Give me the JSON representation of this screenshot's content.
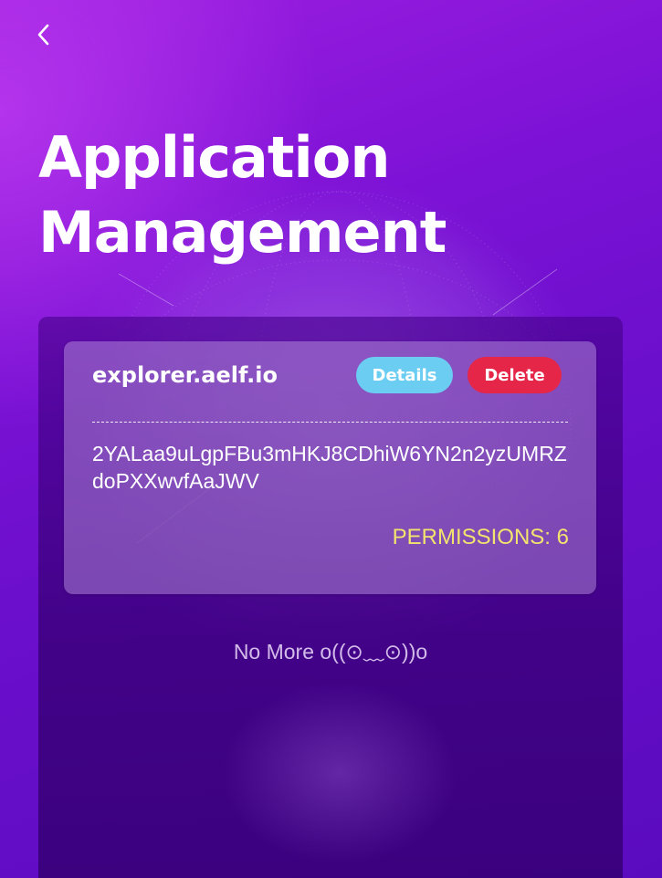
{
  "header": {
    "back_icon": "chevron-left-icon",
    "title": "Application Management"
  },
  "applications": [
    {
      "name": "explorer.aelf.io",
      "details_label": "Details",
      "delete_label": "Delete",
      "address": "2YALaa9uLgpFBu3mHKJ8CDhiW6YN2n2yzUMRZdoPXXwvfAaJWV",
      "permissions": "PERMISSIONS: 6"
    }
  ],
  "list_end_text": "No More o((⊙﹏⊙))o",
  "colors": {
    "background_start": "#9d1fe0",
    "background_end": "#5a0bbf",
    "details_button": "#6ccdf3",
    "delete_button": "#e52648",
    "permissions_text": "#f2e46e"
  }
}
